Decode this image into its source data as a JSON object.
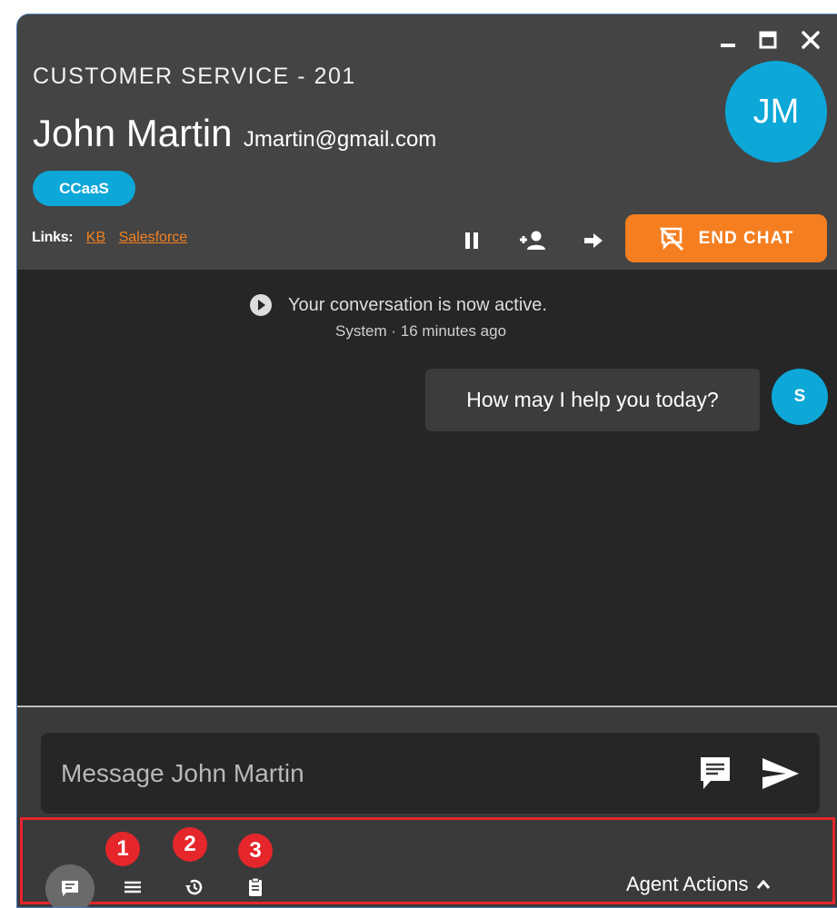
{
  "window": {
    "controls": {
      "minimize_icon": "minimize-icon",
      "maximize_icon": "maximize-icon",
      "close_icon": "close-icon"
    }
  },
  "header": {
    "queue": "CUSTOMER SERVICE - 201",
    "customer_name": "John Martin",
    "customer_email": "Jmartin@gmail.com",
    "avatar_initials": "JM",
    "tag": "CCaaS",
    "links": {
      "label": "Links:",
      "items": [
        "KB",
        "Salesforce"
      ]
    },
    "controls": {
      "hold_icon": "pause-icon",
      "add_participant_icon": "add-person-icon",
      "transfer_icon": "arrow-right-icon",
      "end_chat_label": "END CHAT"
    }
  },
  "conversation": {
    "system_message": "Your conversation is now active.",
    "system_meta": "System · 16 minutes ago",
    "messages": [
      {
        "sender_initial": "S",
        "text": "How may I help you today?"
      }
    ]
  },
  "composer": {
    "placeholder": "Message John Martin",
    "canned_responses_icon": "message-template-icon",
    "send_icon": "send-icon"
  },
  "toolbar": {
    "tools": [
      {
        "icon": "chat-icon",
        "active": true
      },
      {
        "icon": "menu-lines-icon",
        "badge": "1"
      },
      {
        "icon": "history-icon",
        "badge": "2"
      },
      {
        "icon": "clipboard-icon",
        "badge": "3"
      }
    ],
    "agent_actions_label": "Agent Actions"
  },
  "colors": {
    "accent_blue": "#0da7d8",
    "end_chat_orange": "#f57f20",
    "link_orange": "#f08022",
    "highlight_red": "#e5262b",
    "header_bg": "#444444",
    "conversation_bg": "#262626"
  }
}
